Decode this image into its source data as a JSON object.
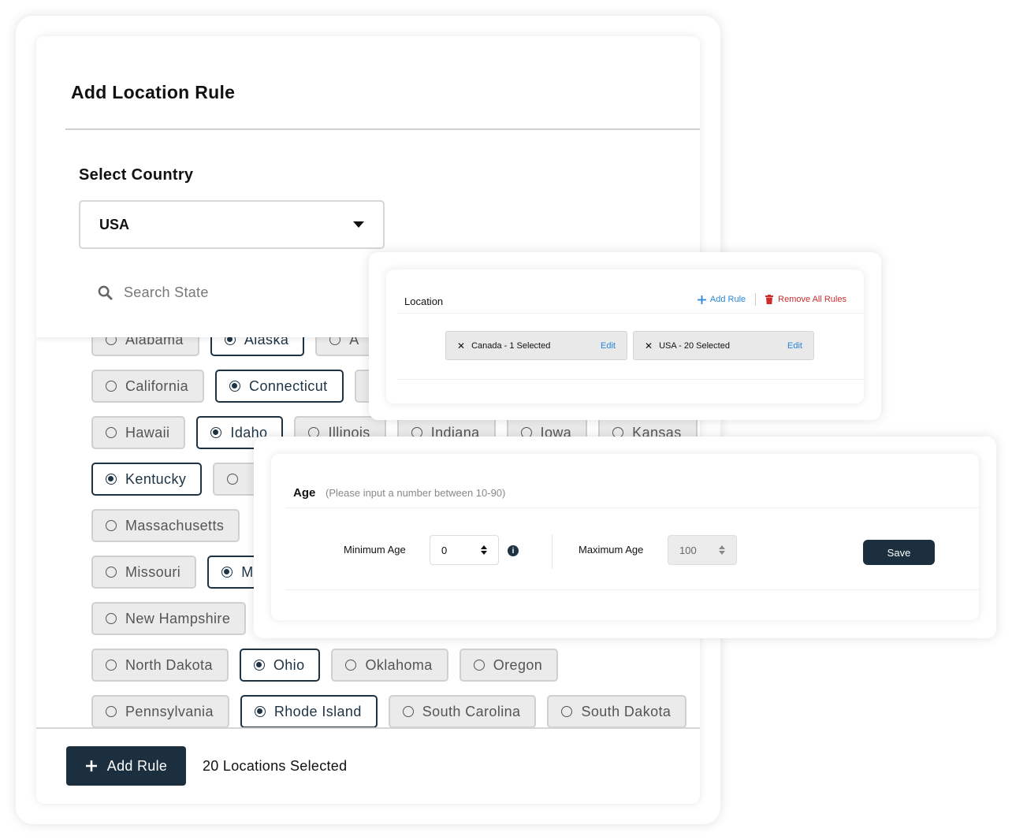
{
  "main": {
    "title": "Add Location Rule",
    "country_label": "Select Country",
    "country_value": "USA",
    "search_placeholder": "Search State",
    "state_rows": [
      [
        {
          "label": "Alabama",
          "selected": false
        },
        {
          "label": "Alaska",
          "selected": true
        },
        {
          "label": "A",
          "selected": false
        }
      ],
      [
        {
          "label": "California",
          "selected": false
        },
        {
          "label": "Connecticut",
          "selected": true
        },
        {
          "label": "",
          "selected": false
        }
      ],
      [
        {
          "label": "Hawaii",
          "selected": false
        },
        {
          "label": "Idaho",
          "selected": true
        },
        {
          "label": "Illinois",
          "selected": false
        },
        {
          "label": "Indiana",
          "selected": false
        },
        {
          "label": "Iowa",
          "selected": false
        },
        {
          "label": "Kansas",
          "selected": false
        }
      ],
      [
        {
          "label": "Kentucky",
          "selected": true
        },
        {
          "label": "",
          "selected": false
        }
      ],
      [
        {
          "label": "Massachusetts",
          "selected": false
        }
      ],
      [
        {
          "label": "Missouri",
          "selected": false
        },
        {
          "label": "M",
          "selected": true
        }
      ],
      [
        {
          "label": "New Hampshire",
          "selected": false
        }
      ],
      [
        {
          "label": "North Dakota",
          "selected": false
        },
        {
          "label": "Ohio",
          "selected": true
        },
        {
          "label": "Oklahoma",
          "selected": false
        },
        {
          "label": "Oregon",
          "selected": false
        }
      ],
      [
        {
          "label": "Pennsylvania",
          "selected": false
        },
        {
          "label": "Rhode Island",
          "selected": true
        },
        {
          "label": "South Carolina",
          "selected": false
        },
        {
          "label": "South Dakota",
          "selected": false
        }
      ]
    ],
    "add_rule_label": "Add Rule",
    "selected_count": "20 Locations Selected"
  },
  "location_panel": {
    "title": "Location",
    "add_rule": "Add Rule",
    "remove_all": "Remove All Rules",
    "tags": [
      {
        "label": "Canada - 1 Selected",
        "edit": "Edit"
      },
      {
        "label": "USA - 20 Selected",
        "edit": "Edit"
      }
    ]
  },
  "age_panel": {
    "title": "Age",
    "hint": "(Please input a number between 10-90)",
    "min_label": "Minimum Age",
    "min_value": "0",
    "max_label": "Maximum Age",
    "max_value": "100",
    "save": "Save"
  },
  "colors": {
    "primary": "#1b2f3e",
    "link": "#2a86d8",
    "danger": "#cc2e2e"
  }
}
